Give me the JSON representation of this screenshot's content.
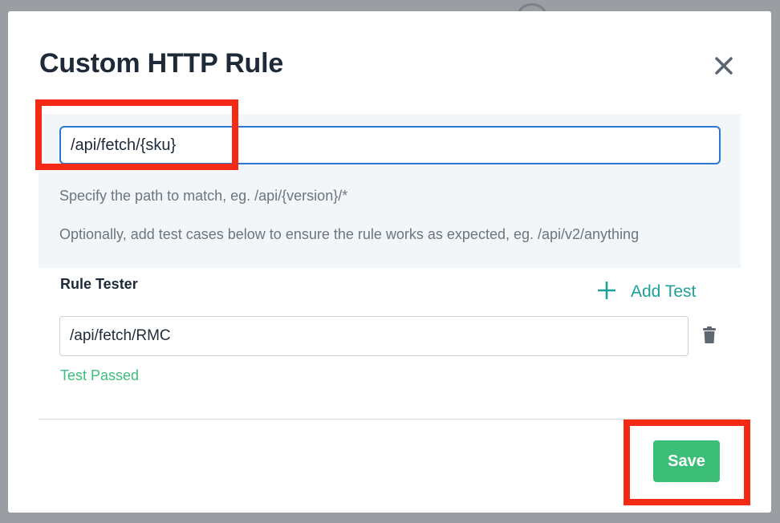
{
  "modal": {
    "title": "Custom HTTP Rule",
    "close_icon": "close-icon"
  },
  "path": {
    "value": "/api/fetch/{sku}",
    "hint_match": "Specify the path to match, eg. /api/{version}/*",
    "hint_tests": "Optionally, add test cases below to ensure the rule works as expected, eg. /api/v2/anything"
  },
  "tester": {
    "label": "Rule Tester",
    "add_test_label": "Add Test",
    "add_icon": "plus-icon",
    "tests": [
      {
        "value": "/api/fetch/RMC",
        "status": "Test Passed",
        "delete_icon": "trash-icon"
      }
    ]
  },
  "footer": {
    "save_label": "Save"
  },
  "colors": {
    "accent_teal": "#1fa19a",
    "success_green": "#3cbe78",
    "focus_blue": "#2b78d3",
    "highlight_red": "#f32a16"
  }
}
